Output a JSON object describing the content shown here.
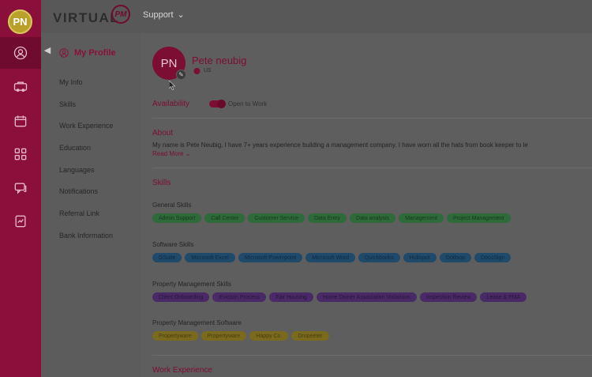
{
  "user": {
    "initials": "PN",
    "name": "Pete neubig",
    "location": "US"
  },
  "header": {
    "logo_word": "VIRTUAL",
    "logo_pm": "PM",
    "support_label": "Support",
    "collapse_glyph": "◀"
  },
  "rail": {
    "icons": [
      "user-icon",
      "truck-icon",
      "calendar-icon",
      "grid-icon",
      "chat-icon",
      "document-icon"
    ]
  },
  "sidenav": {
    "profile_label": "My Profile",
    "items": [
      "My Info",
      "Skills",
      "Work Experience",
      "Education",
      "Languages",
      "Notifications",
      "Referral Link",
      "Bank Information"
    ]
  },
  "main": {
    "availability_title": "Availability",
    "availability_label": "Open to Work",
    "about_title": "About",
    "about_text": "My name is Pete Neubig, I have 7+ years experience building a management company. I have worn all the hats from book keeper to le",
    "read_more": "Read More ⌄",
    "skills_title": "Skills",
    "groups": [
      {
        "title": "General Skills",
        "color": "green",
        "chips": [
          "Admin Support",
          "Call Center",
          "Customer Service",
          "Data Entry",
          "Data analysis",
          "Management",
          "Project Management"
        ]
      },
      {
        "title": "Software Skills",
        "color": "blue",
        "chips": [
          "GSuite",
          "Microsoft Excel",
          "Microsoft Powerpoint",
          "Microsoft Word",
          "Quickbooks",
          "Hubspot",
          "Dotloop",
          "DocuSign"
        ]
      },
      {
        "title": "Property Management Skills",
        "color": "purple",
        "chips": [
          "Client Onboarding",
          "Eviction Process",
          "Fair Housing",
          "Home Owner Association Violations",
          "Inspection Review",
          "Lease & PMA"
        ]
      },
      {
        "title": "Property Management Software",
        "color": "yellow",
        "chips": [
          "Propertyware",
          "Propertyware",
          "Happy Co.",
          "Dropeeter"
        ]
      }
    ],
    "work_title": "Work Experience"
  }
}
